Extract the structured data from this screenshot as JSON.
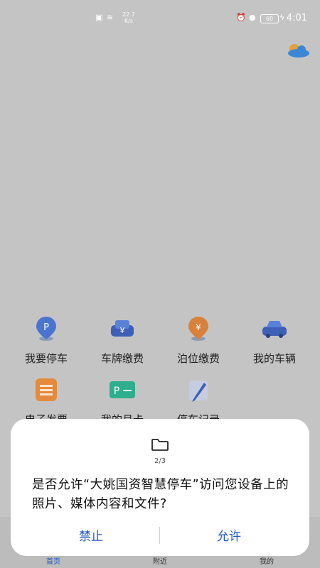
{
  "status_bar": {
    "net_speed": "22.7\nK/s",
    "battery": "60",
    "time": "4:01"
  },
  "weather": {
    "icon": "partly-cloudy-icon"
  },
  "grid": [
    {
      "label": "我要停车",
      "icon": "parking-pin-icon"
    },
    {
      "label": "车牌缴费",
      "icon": "car-yuan-icon"
    },
    {
      "label": "泊位缴费",
      "icon": "yuan-pin-icon"
    },
    {
      "label": "我的车辆",
      "icon": "car-icon"
    },
    {
      "label": "电子发票",
      "icon": "invoice-icon"
    },
    {
      "label": "我的月卡",
      "icon": "monthly-card-icon"
    },
    {
      "label": "停车记录",
      "icon": "record-pencil-icon"
    }
  ],
  "bottom_nav": [
    {
      "label": "首页"
    },
    {
      "label": "附近"
    },
    {
      "label": "我的"
    }
  ],
  "dialog": {
    "page_indicator": "2/3",
    "message": "是否允许“大姚国资智慧停车”访问您设备上的照片、媒体内容和文件?",
    "deny_label": "禁止",
    "allow_label": "允许"
  },
  "colors": {
    "accent": "#1d56c9",
    "dim_background": "#c4c4c4"
  }
}
